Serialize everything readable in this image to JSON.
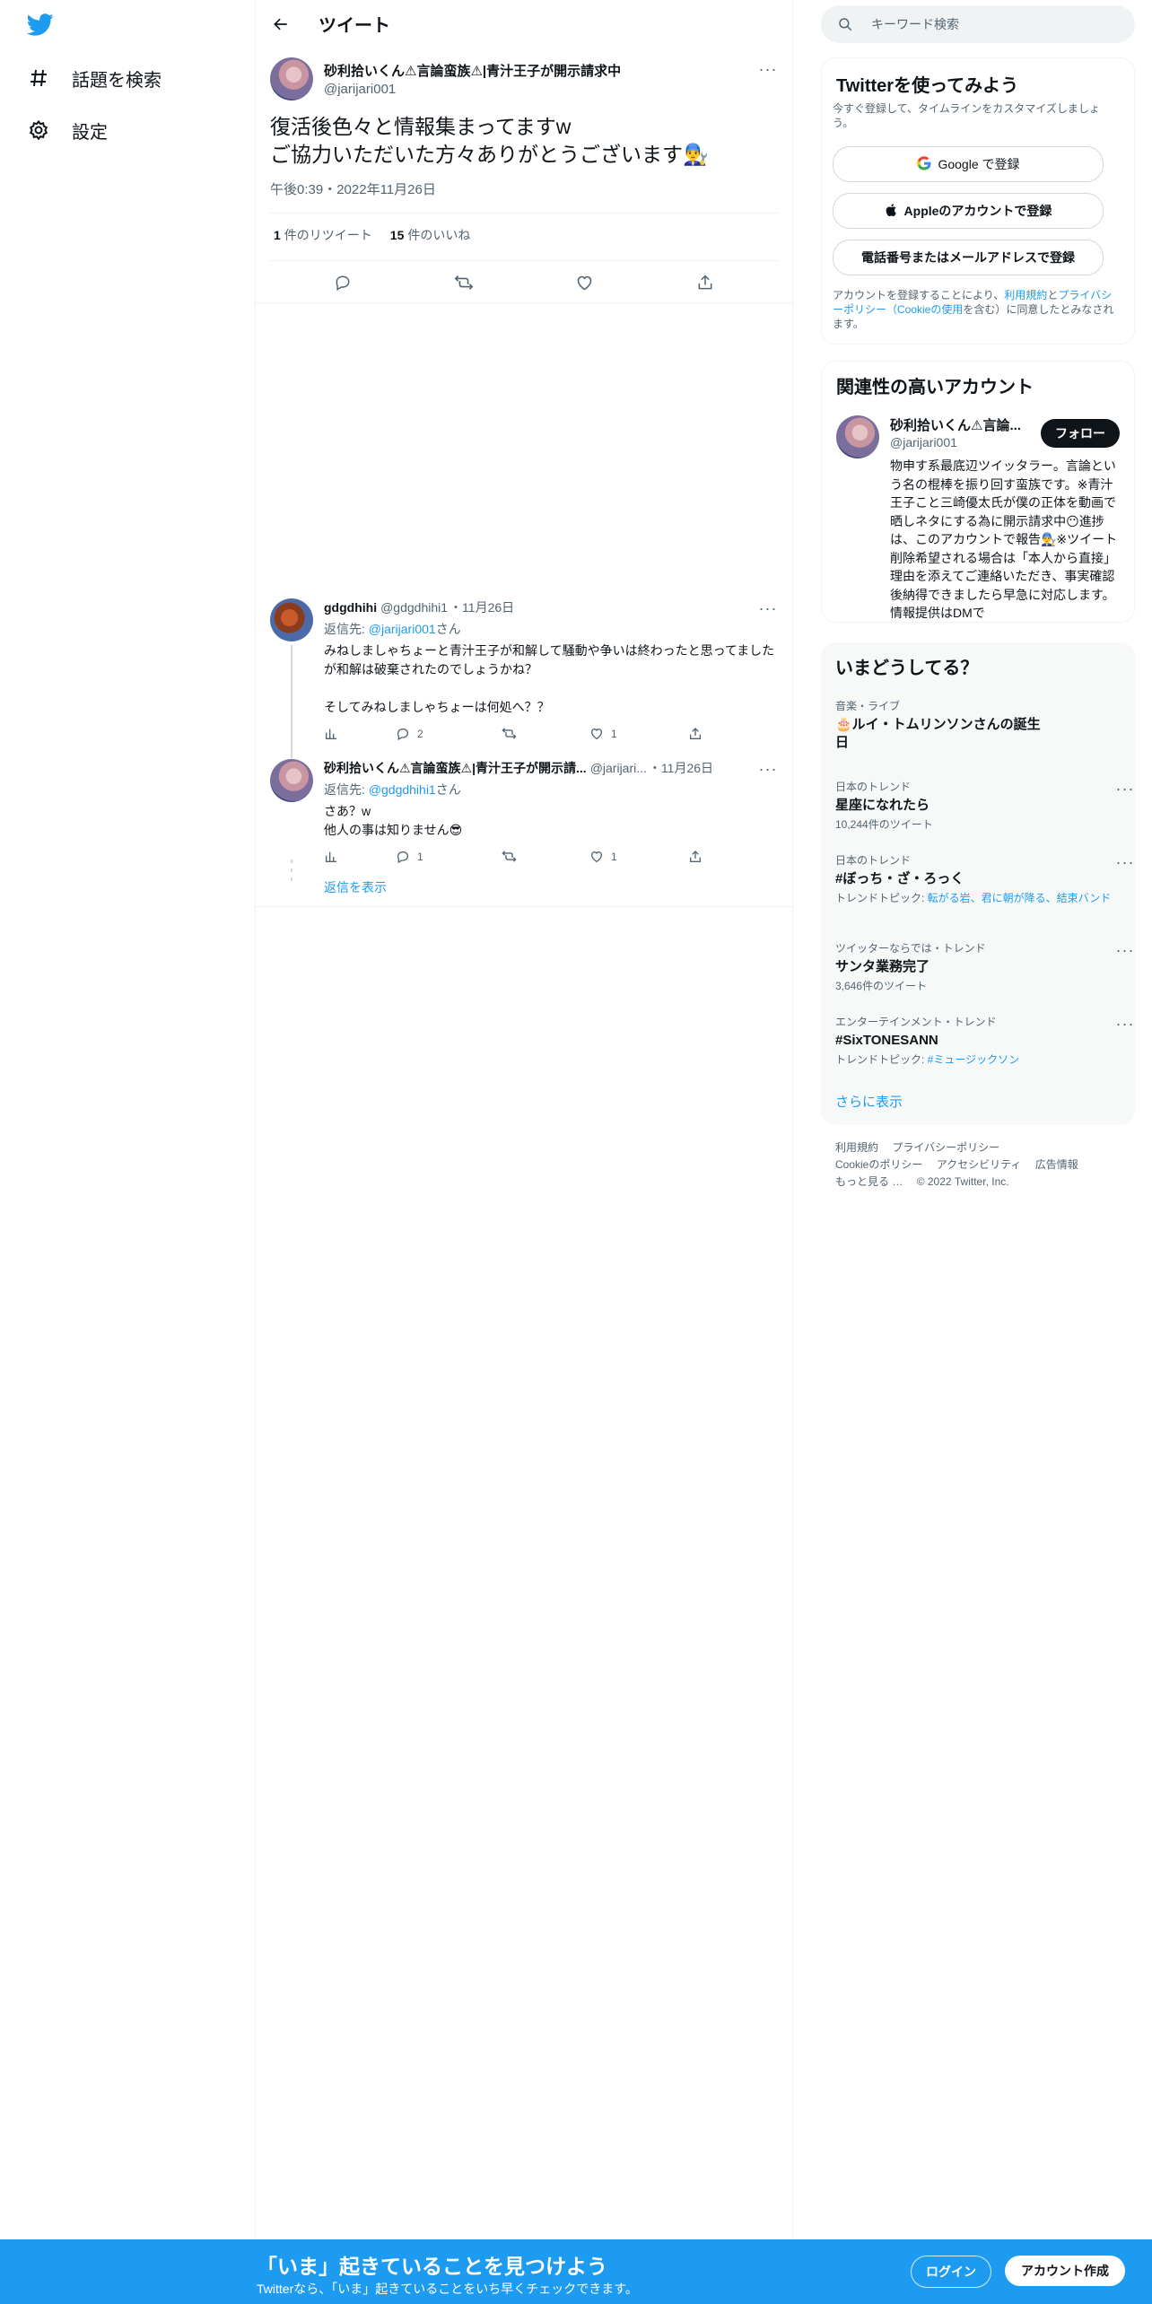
{
  "nav": {
    "logo": "twitter-bird-icon",
    "items": [
      {
        "label": "話題を検索",
        "icon": "hashtag-icon"
      },
      {
        "label": "設定",
        "icon": "gear-icon"
      }
    ]
  },
  "header": {
    "title": "ツイート"
  },
  "tweet": {
    "name": "砂利拾いくん⚠言論蛮族⚠|青汁王子が開示請求中",
    "handle": "@jarijari001",
    "text": "復活後色々と情報集まってますw\nご協力いただいた方々ありがとうございます👨‍🔧",
    "time": "午後0:39・2022年11月26日",
    "retweets_count": "1",
    "retweets_label": "件のリツイート",
    "likes_count": "15",
    "likes_label": "件のいいね"
  },
  "replies": [
    {
      "name": "gdgdhihi",
      "handle": "@gdgdhihi1",
      "date": "・11月26日",
      "replyto_prefix": "返信先: ",
      "replyto_handle": "@jarijari001",
      "replyto_suffix": "さん",
      "text": "みねしましゃちょーと青汁王子が和解して騒動や争いは終わったと思ってましたが和解は破棄されたのでしょうかね？\n\nそしてみねしましゃちょーは何処へ？？",
      "reply_count": "2",
      "retweet_count": "",
      "like_count": "1"
    },
    {
      "name": "砂利拾いくん⚠言論蛮族⚠|青汁王子が開示請...",
      "handle": "@jarijari...",
      "date": "・11月26日",
      "replyto_prefix": "返信先: ",
      "replyto_handle": "@gdgdhihi1",
      "replyto_suffix": "さん",
      "text": "さあ？w\n他人の事は知りません😎",
      "reply_count": "1",
      "retweet_count": "",
      "like_count": "1"
    }
  ],
  "show_replies": "返信を表示",
  "search": {
    "placeholder": "キーワード検索"
  },
  "signup_card": {
    "title": "Twitterを使ってみよう",
    "subtitle": "今すぐ登録して、タイムラインをカスタマイズしましょう。",
    "google": "Google で登録",
    "apple": "Appleのアカウントで登録",
    "phone": "電話番号またはメールアドレスで登録",
    "terms_1": "アカウントを登録することにより、",
    "terms_link1": "利用規約",
    "terms_2": "と",
    "terms_link2": "プライバシーポリシー（Cookieの使用",
    "terms_3": "を含む）に同意したとみなされます。"
  },
  "related_card": {
    "title": "関連性の高いアカウント",
    "name": "砂利拾いくん⚠言論...",
    "handle": "@jarijari001",
    "follow": "フォロー",
    "bio": "物申す系最底辺ツイッタラー。言論という名の棍棒を振り回す蛮族です。※青汁王子こと三崎優太氏が僕の正体を動画で晒しネタにする為に開示請求中😶進捗は、このアカウントで報告👨‍🔧※ツイート削除希望される場合は「本人から直接」理由を添えてご連絡いただき、事実確認後納得できましたら早急に対応します。情報提供はDMで"
  },
  "trends_card": {
    "title": "いまどうしてる？",
    "items": [
      {
        "category": "音楽・ライブ",
        "name": "🎂ルイ・トムリンソンさんの誕生日",
        "sub": "",
        "sub_link": ""
      },
      {
        "category": "日本のトレンド",
        "name": "星座になれたら",
        "sub": "10,244件のツイート",
        "sub_link": ""
      },
      {
        "category": "日本のトレンド",
        "name": "#ぼっち・ざ・ろっく",
        "sub": "トレンドトピック: ",
        "sub_link": "転がる岩、君に朝が降る、結束バンド"
      },
      {
        "category": "ツイッターならでは・トレンド",
        "name": "サンタ業務完了",
        "sub": "3,646件のツイート",
        "sub_link": ""
      },
      {
        "category": "エンターテインメント・トレンド",
        "name": "#SixTONESANN",
        "sub": "トレンドトピック: ",
        "sub_link": "#ミュージックソン"
      }
    ],
    "more": "さらに表示"
  },
  "footer": {
    "links": [
      "利用規約",
      "プライバシーポリシー",
      "Cookieのポリシー",
      "アクセシビリティ",
      "広告情報",
      "もっと見る …"
    ],
    "copyright": "© 2022 Twitter, Inc."
  },
  "bottom_bar": {
    "title": "「いま」起きていることを見つけよう",
    "subtitle": "Twitterなら、「いま」起きていることをいち早くチェックできます。",
    "login": "ログイン",
    "signup": "アカウント作成"
  },
  "colors": {
    "brand": "#1d9bf0",
    "text": "#0f1419",
    "muted": "#536471",
    "border": "#eff3f4"
  }
}
